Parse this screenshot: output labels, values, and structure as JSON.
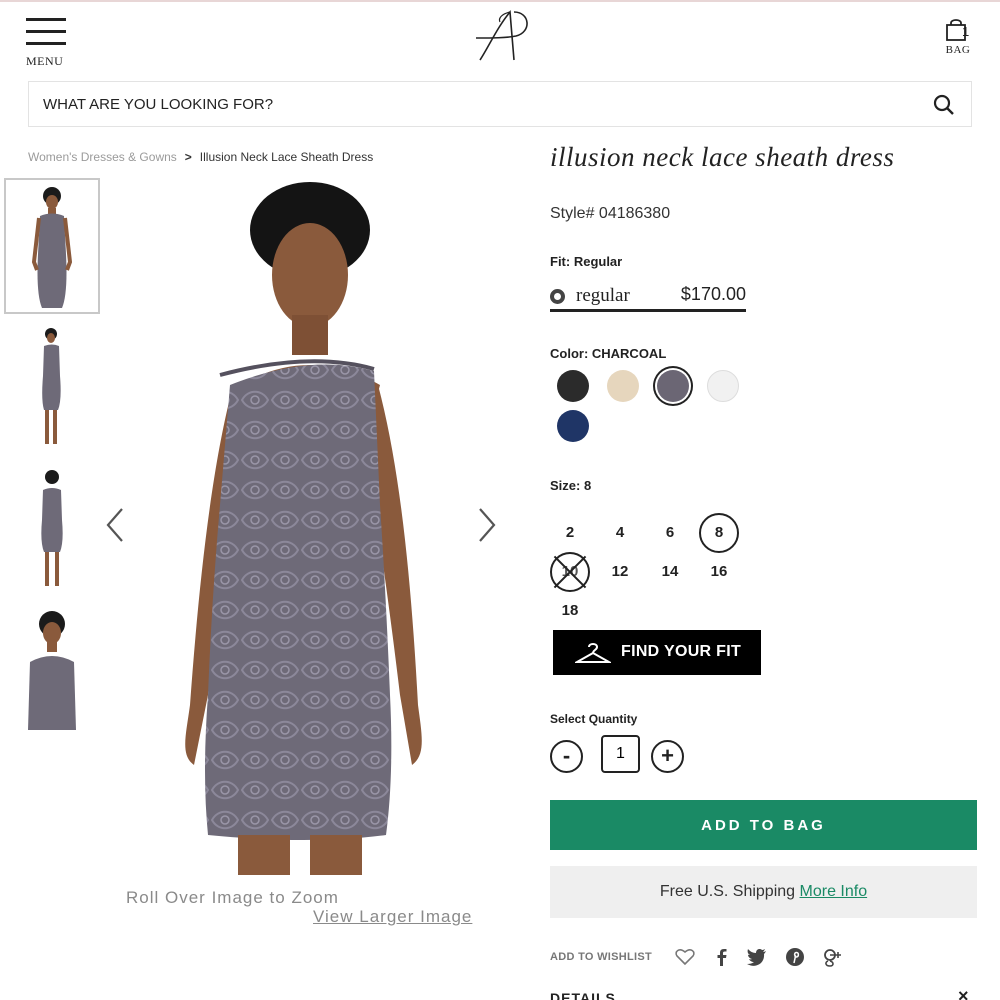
{
  "header": {
    "menu_label": "MENU",
    "bag_label": "BAG",
    "bag_count": "1"
  },
  "search": {
    "placeholder": "WHAT ARE YOU LOOKING FOR?"
  },
  "breadcrumb": {
    "items": [
      "Women's Dresses & Gowns",
      "Illusion Neck Lace Sheath Dress"
    ],
    "separator": ">"
  },
  "gallery": {
    "thumbnails": [
      "front",
      "side",
      "back",
      "detail"
    ],
    "selected": "front",
    "roll_over_text": "Roll Over Image to Zoom",
    "view_larger_text": "View Larger Image"
  },
  "product": {
    "title": "illusion neck lace sheath dress",
    "style": "Style# 04186380",
    "fit_label": "Fit: Regular",
    "fit_option": {
      "name": "regular",
      "price": "$170.00"
    },
    "color_label": "Color: CHARCOAL",
    "colors": [
      {
        "name": "black",
        "hex": "#2b2b2b",
        "selected": false
      },
      {
        "name": "champagne",
        "hex": "#e6d6bd",
        "selected": false
      },
      {
        "name": "charcoal",
        "hex": "#6b6674",
        "selected": true
      },
      {
        "name": "white",
        "hex": "#f1f1f1",
        "selected": false
      },
      {
        "name": "navy",
        "hex": "#1f3566",
        "selected": false
      }
    ],
    "size_label": "Size: 8",
    "sizes": [
      {
        "label": "2",
        "state": "available"
      },
      {
        "label": "4",
        "state": "available"
      },
      {
        "label": "6",
        "state": "available"
      },
      {
        "label": "8",
        "state": "selected"
      },
      {
        "label": "10",
        "state": "unavailable"
      },
      {
        "label": "12",
        "state": "available"
      },
      {
        "label": "14",
        "state": "available"
      },
      {
        "label": "16",
        "state": "available"
      },
      {
        "label": "18",
        "state": "available"
      }
    ],
    "find_fit_label": "FIND YOUR FIT",
    "quantity_label": "Select Quantity",
    "quantity": "1",
    "quantity_minus": "-",
    "quantity_plus": "+",
    "add_to_bag_label": "ADD TO BAG",
    "shipping_text": "Free U.S. Shipping",
    "shipping_link": "More Info",
    "wishlist_label": "ADD TO WISHLIST",
    "share_icons": [
      "heart-icon",
      "facebook-icon",
      "twitter-icon",
      "pinterest-icon",
      "google-plus-icon"
    ],
    "details_label": "DETAILS",
    "details_toggle": "×"
  },
  "colors": {
    "accent": "#1a8a65",
    "dress": "#6e6a78",
    "skin": "#8a5a3c"
  }
}
